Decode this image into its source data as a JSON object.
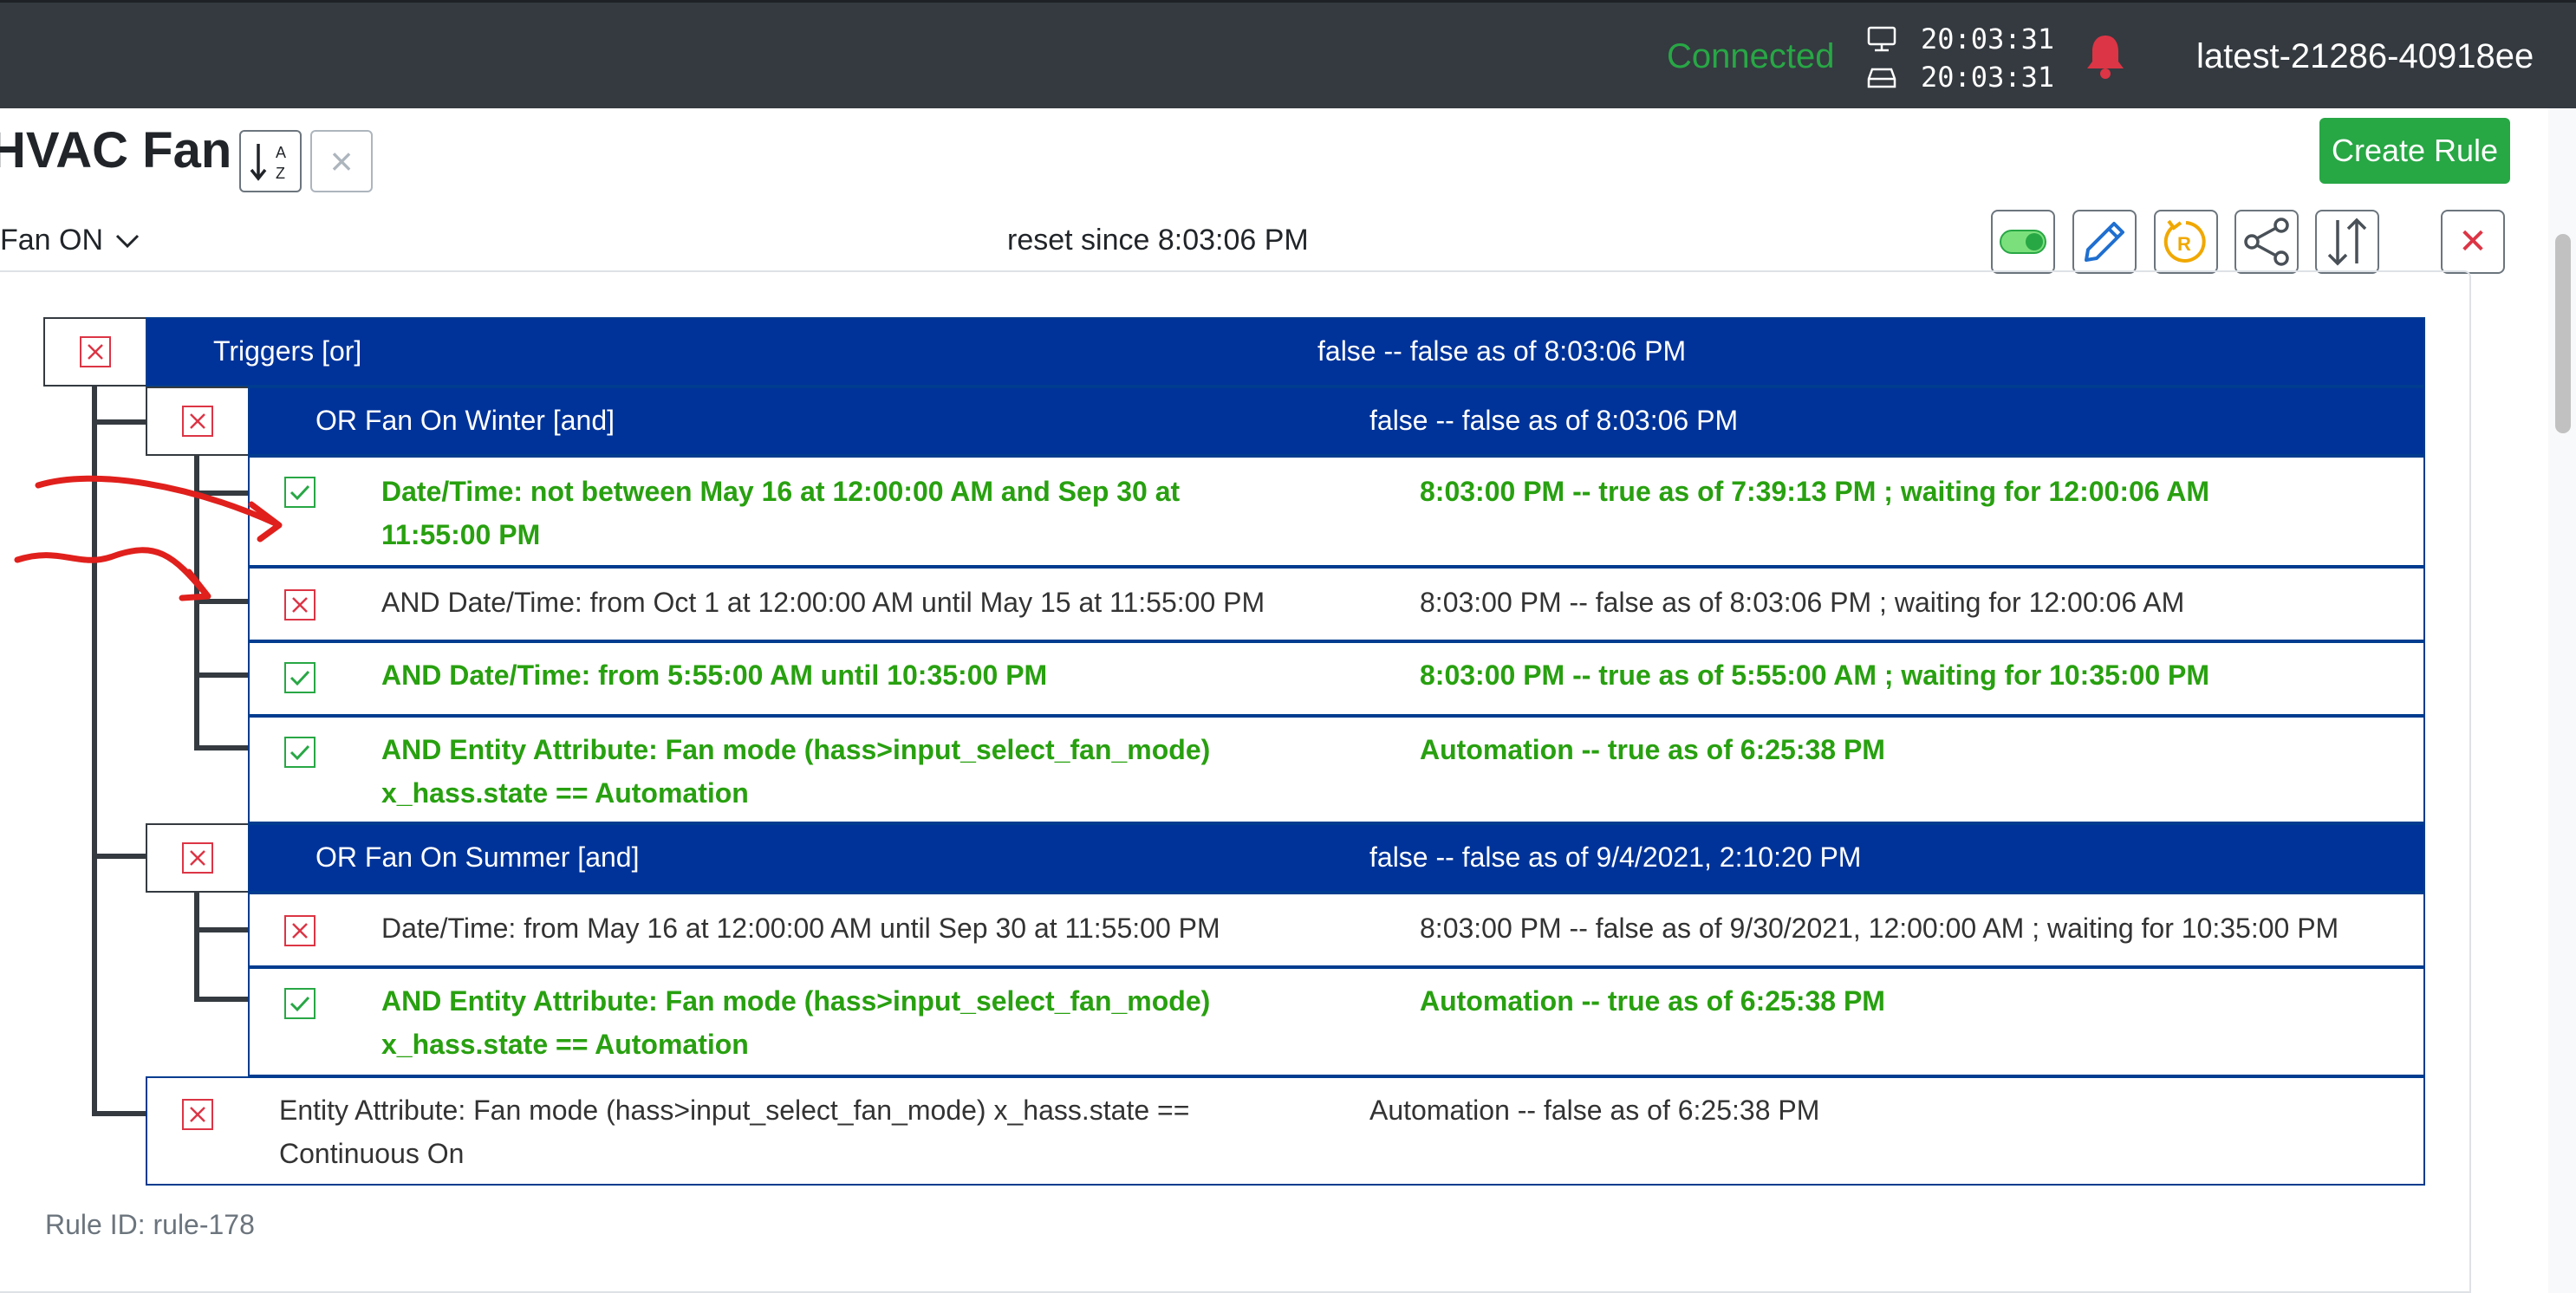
{
  "topbar": {
    "status": "Connected",
    "client_time": "20:03:31",
    "server_time": "20:03:31",
    "instance": "latest-21286-40918ee"
  },
  "header": {
    "title": "HVAC Fan",
    "clear_label": "×",
    "create_rule": "Create Rule",
    "rule_select": "Fan ON",
    "reset_since": "reset since 8:03:06 PM",
    "delete_label": "✕"
  },
  "tree": {
    "triggers": {
      "label": "Triggers [or]",
      "status": "false -- false as of 8:03:06 PM"
    },
    "winter": {
      "label": "OR Fan On Winter [and]",
      "status": "false -- false as of 8:03:06 PM",
      "conditions": [
        {
          "line1": "Date/Time: not between May 16 at 12:00:00 AM and Sep 30 at",
          "line2": "11:55:00 PM",
          "status": "8:03:00 PM -- true as of 7:39:13 PM ; waiting for 12:00:06 AM"
        },
        {
          "line1": "AND Date/Time: from Oct 1 at 12:00:00 AM until May 15 at 11:55:00 PM",
          "line2": "",
          "status": "8:03:00 PM -- false as of 8:03:06 PM ; waiting for 12:00:06 AM"
        },
        {
          "line1": "AND Date/Time: from 5:55:00 AM until 10:35:00 PM",
          "line2": "",
          "status": "8:03:00 PM -- true as of 5:55:00 AM ; waiting for 10:35:00 PM"
        },
        {
          "line1": "AND Entity Attribute: Fan mode (hass>input_select_fan_mode)",
          "line2": "x_hass.state == Automation",
          "status": "Automation -- true as of 6:25:38 PM"
        }
      ]
    },
    "summer": {
      "label": "OR Fan On Summer [and]",
      "status": "false -- false as of 9/4/2021, 2:10:20 PM",
      "conditions": [
        {
          "line1": "Date/Time: from May 16 at 12:00:00 AM until Sep 30 at 11:55:00 PM",
          "line2": "",
          "status": "8:03:00 PM -- false as of 9/30/2021, 12:00:00 AM ; waiting for 10:35:00 PM"
        },
        {
          "line1": "AND Entity Attribute: Fan mode (hass>input_select_fan_mode)",
          "line2": "x_hass.state == Automation",
          "status": "Automation -- true as of 6:25:38 PM"
        }
      ]
    },
    "continuous": {
      "line1": "Entity Attribute: Fan mode (hass>input_select_fan_mode) x_hass.state ==",
      "line2": "Continuous On",
      "status": "Automation -- false as of 6:25:38 PM"
    }
  },
  "footer": {
    "rule_id": "Rule ID: rule-178"
  },
  "colors": {
    "topbar": "#343a40",
    "connected": "#28a745",
    "group_header": "#003399",
    "true_text": "#28a010",
    "false_icon": "#dc3545",
    "annotation": "#e0201c"
  },
  "icons": [
    "monitor-icon",
    "server-icon",
    "bell-icon",
    "sort-az-icon",
    "chevron-down-icon",
    "toggle-icon",
    "pencil-icon",
    "reset-icon",
    "share-icon",
    "sort-arrows-icon",
    "close-icon",
    "checkbox-checked-icon",
    "checkbox-x-icon"
  ]
}
